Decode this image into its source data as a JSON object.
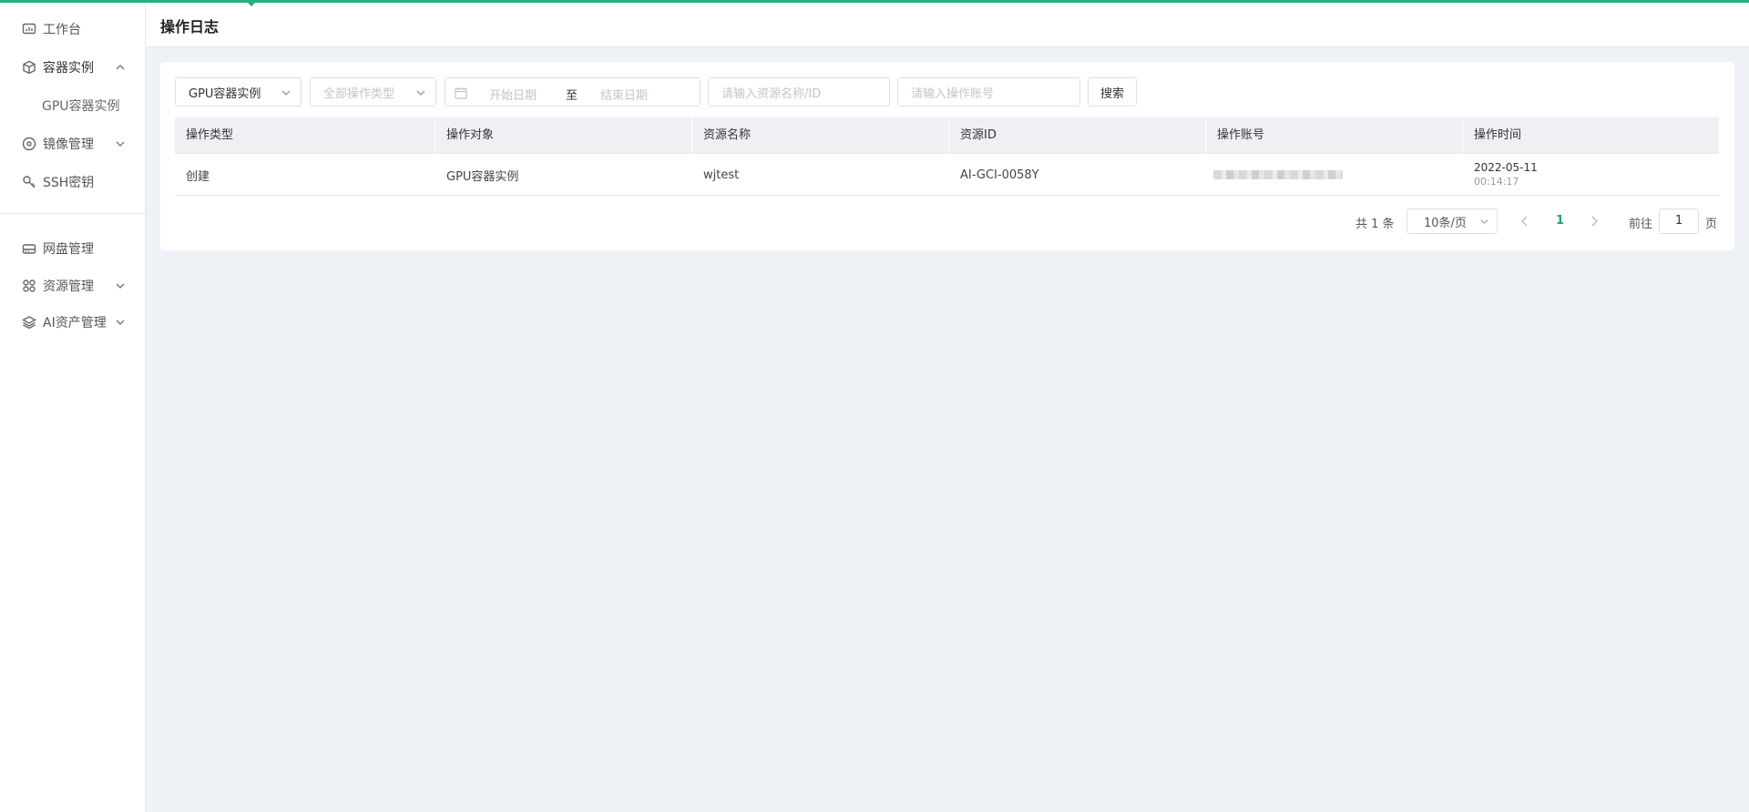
{
  "colors": {
    "accent": "#27ae85",
    "active_page": "#1aa37a"
  },
  "sidebar": {
    "items": [
      {
        "label": "工作台",
        "icon": "dashboard-icon"
      },
      {
        "label": "容器实例",
        "icon": "cube-icon",
        "expanded": true,
        "children": [
          {
            "label": "GPU容器实例"
          }
        ]
      },
      {
        "label": "镜像管理",
        "icon": "disc-icon"
      },
      {
        "label": "SSH密钥",
        "icon": "key-icon"
      },
      {
        "label": "网盘管理",
        "icon": "drive-icon"
      },
      {
        "label": "资源管理",
        "icon": "grid-icon"
      },
      {
        "label": "AI资产管理",
        "icon": "layers-icon"
      }
    ]
  },
  "header": {
    "title": "操作日志"
  },
  "filters": {
    "resource_type": "GPU容器实例",
    "operation_type_placeholder": "全部操作类型",
    "start_date_placeholder": "开始日期",
    "date_separator": "至",
    "end_date_placeholder": "结束日期",
    "resource_placeholder": "请输入资源名称/ID",
    "account_placeholder": "请输入操作账号",
    "search_label": "搜索"
  },
  "table": {
    "columns": [
      "操作类型",
      "操作对象",
      "资源名称",
      "资源ID",
      "操作账号",
      "操作时间"
    ],
    "rows": [
      {
        "op_type": "创建",
        "target": "GPU容器实例",
        "name": "wjtest",
        "id": "AI-GCI-0058Y",
        "account": "",
        "date": "2022-05-11",
        "time": "00:14:17"
      }
    ]
  },
  "pagination": {
    "total_text": "共 1 条",
    "page_size": "10条/页",
    "current_page": "1",
    "goto_prefix": "前往",
    "goto_value": "1",
    "goto_suffix": "页"
  }
}
